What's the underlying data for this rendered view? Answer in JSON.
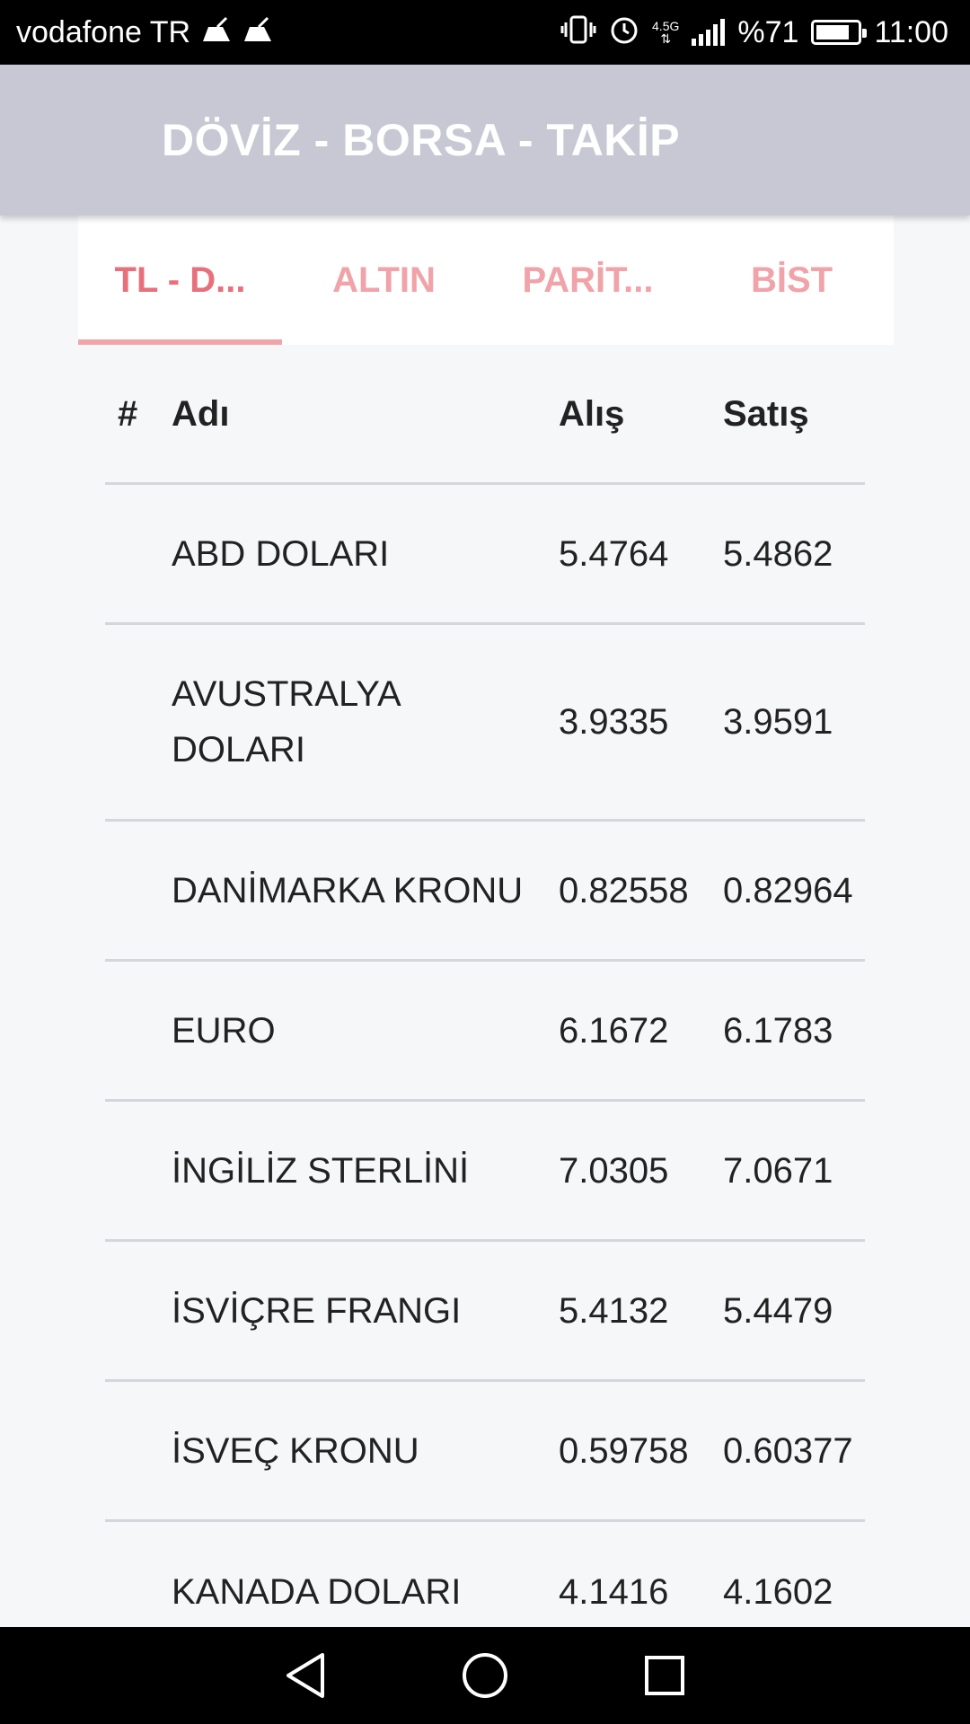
{
  "status_bar": {
    "carrier": "vodafone TR",
    "network_type_top": "4.5G",
    "battery_text": "%71",
    "battery_level": 0.71,
    "time": "11:00",
    "icons": [
      "vibrate-icon",
      "alarm-icon",
      "signal-icon",
      "battery-icon",
      "notification-app-icon"
    ]
  },
  "app_bar": {
    "title": "DÖVİZ - BORSA - TAKİP",
    "background_color": "#c7c8d3"
  },
  "tabs": [
    {
      "label": "TL - D...",
      "active": true
    },
    {
      "label": "ALTIN",
      "active": false
    },
    {
      "label": "PARİT...",
      "active": false
    },
    {
      "label": "BİST",
      "active": false
    }
  ],
  "accent_color": "#e8707b",
  "table": {
    "headers": {
      "num": "#",
      "name": "Adı",
      "buy": "Alış",
      "sell": "Satış"
    },
    "rows": [
      {
        "num": "",
        "name": "ABD DOLARI",
        "buy": "5.4764",
        "sell": "5.4862"
      },
      {
        "num": "",
        "name": "AVUSTRALYA DOLARI",
        "buy": "3.9335",
        "sell": "3.9591"
      },
      {
        "num": "",
        "name": "DANİMARKA KRONU",
        "buy": "0.82558",
        "sell": "0.82964"
      },
      {
        "num": "",
        "name": "EURO",
        "buy": "6.1672",
        "sell": "6.1783"
      },
      {
        "num": "",
        "name": "İNGİLİZ STERLİNİ",
        "buy": "7.0305",
        "sell": "7.0671"
      },
      {
        "num": "",
        "name": "İSVİÇRE FRANGI",
        "buy": "5.4132",
        "sell": "5.4479"
      },
      {
        "num": "",
        "name": "İSVEÇ KRONU",
        "buy": "0.59758",
        "sell": "0.60377"
      },
      {
        "num": "",
        "name": "KANADA DOLARI",
        "buy": "4.1416",
        "sell": "4.1602"
      }
    ]
  },
  "nav_bar": {
    "buttons": [
      "back-icon",
      "home-icon",
      "recents-icon"
    ]
  }
}
